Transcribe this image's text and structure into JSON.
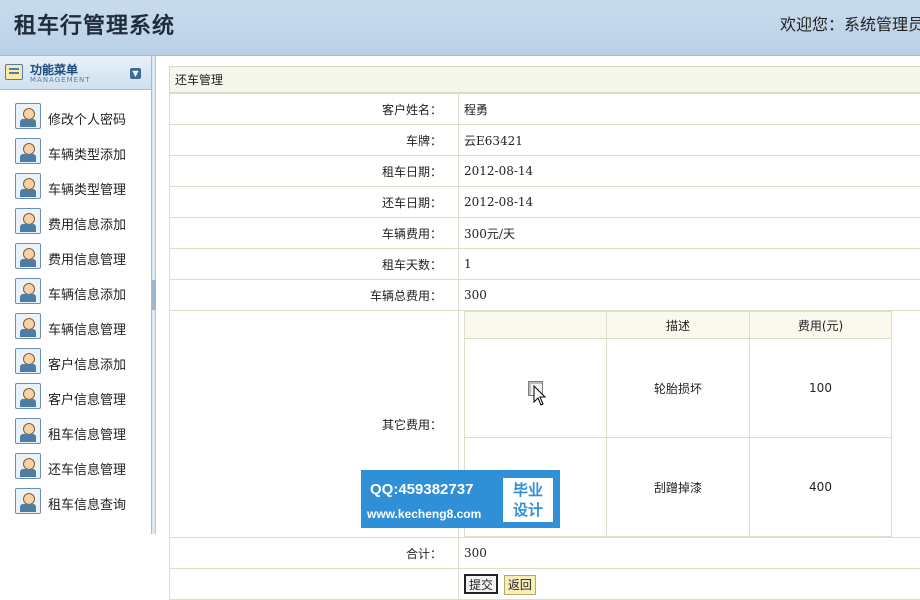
{
  "header": {
    "title": "租车行管理系统",
    "welcome": "欢迎您：系统管理员"
  },
  "sidebar": {
    "title": "功能菜单",
    "subtitle": "MANAGEMENT",
    "items": [
      {
        "label": "修改个人密码"
      },
      {
        "label": "车辆类型添加"
      },
      {
        "label": "车辆类型管理"
      },
      {
        "label": "费用信息添加"
      },
      {
        "label": "费用信息管理"
      },
      {
        "label": "车辆信息添加"
      },
      {
        "label": "车辆信息管理"
      },
      {
        "label": "客户信息添加"
      },
      {
        "label": "客户信息管理"
      },
      {
        "label": "租车信息管理"
      },
      {
        "label": "还车信息管理"
      },
      {
        "label": "租车信息查询"
      }
    ]
  },
  "main": {
    "panel_title": "还车管理",
    "fields": {
      "customer_name_label": "客户姓名：",
      "customer_name": "程勇",
      "plate_label": "车牌：",
      "plate": "云E63421",
      "rent_date_label": "租车日期：",
      "rent_date": "2012-08-14",
      "return_date_label": "还车日期：",
      "return_date": "2012-08-14",
      "fee_label": "车辆费用：",
      "fee": "300元/天",
      "days_label": "租车天数：",
      "days": "1",
      "total_fee_label": "车辆总费用：",
      "total_fee": "300",
      "other_fee_label": "其它费用：",
      "sum_label": "合计：",
      "sum": "300"
    },
    "fees_table": {
      "headers": [
        "",
        "描述",
        "费用(元)"
      ],
      "rows": [
        {
          "desc": "轮胎损坏",
          "amount": "100",
          "checked": false
        },
        {
          "desc": "刮蹭掉漆",
          "amount": "400",
          "checked": false
        }
      ]
    },
    "buttons": {
      "submit": "提交",
      "back": "返回"
    }
  },
  "watermark": {
    "qq": "QQ:459382737",
    "url": "www.kecheng8.com",
    "line1": "毕业",
    "line2": "设计"
  }
}
